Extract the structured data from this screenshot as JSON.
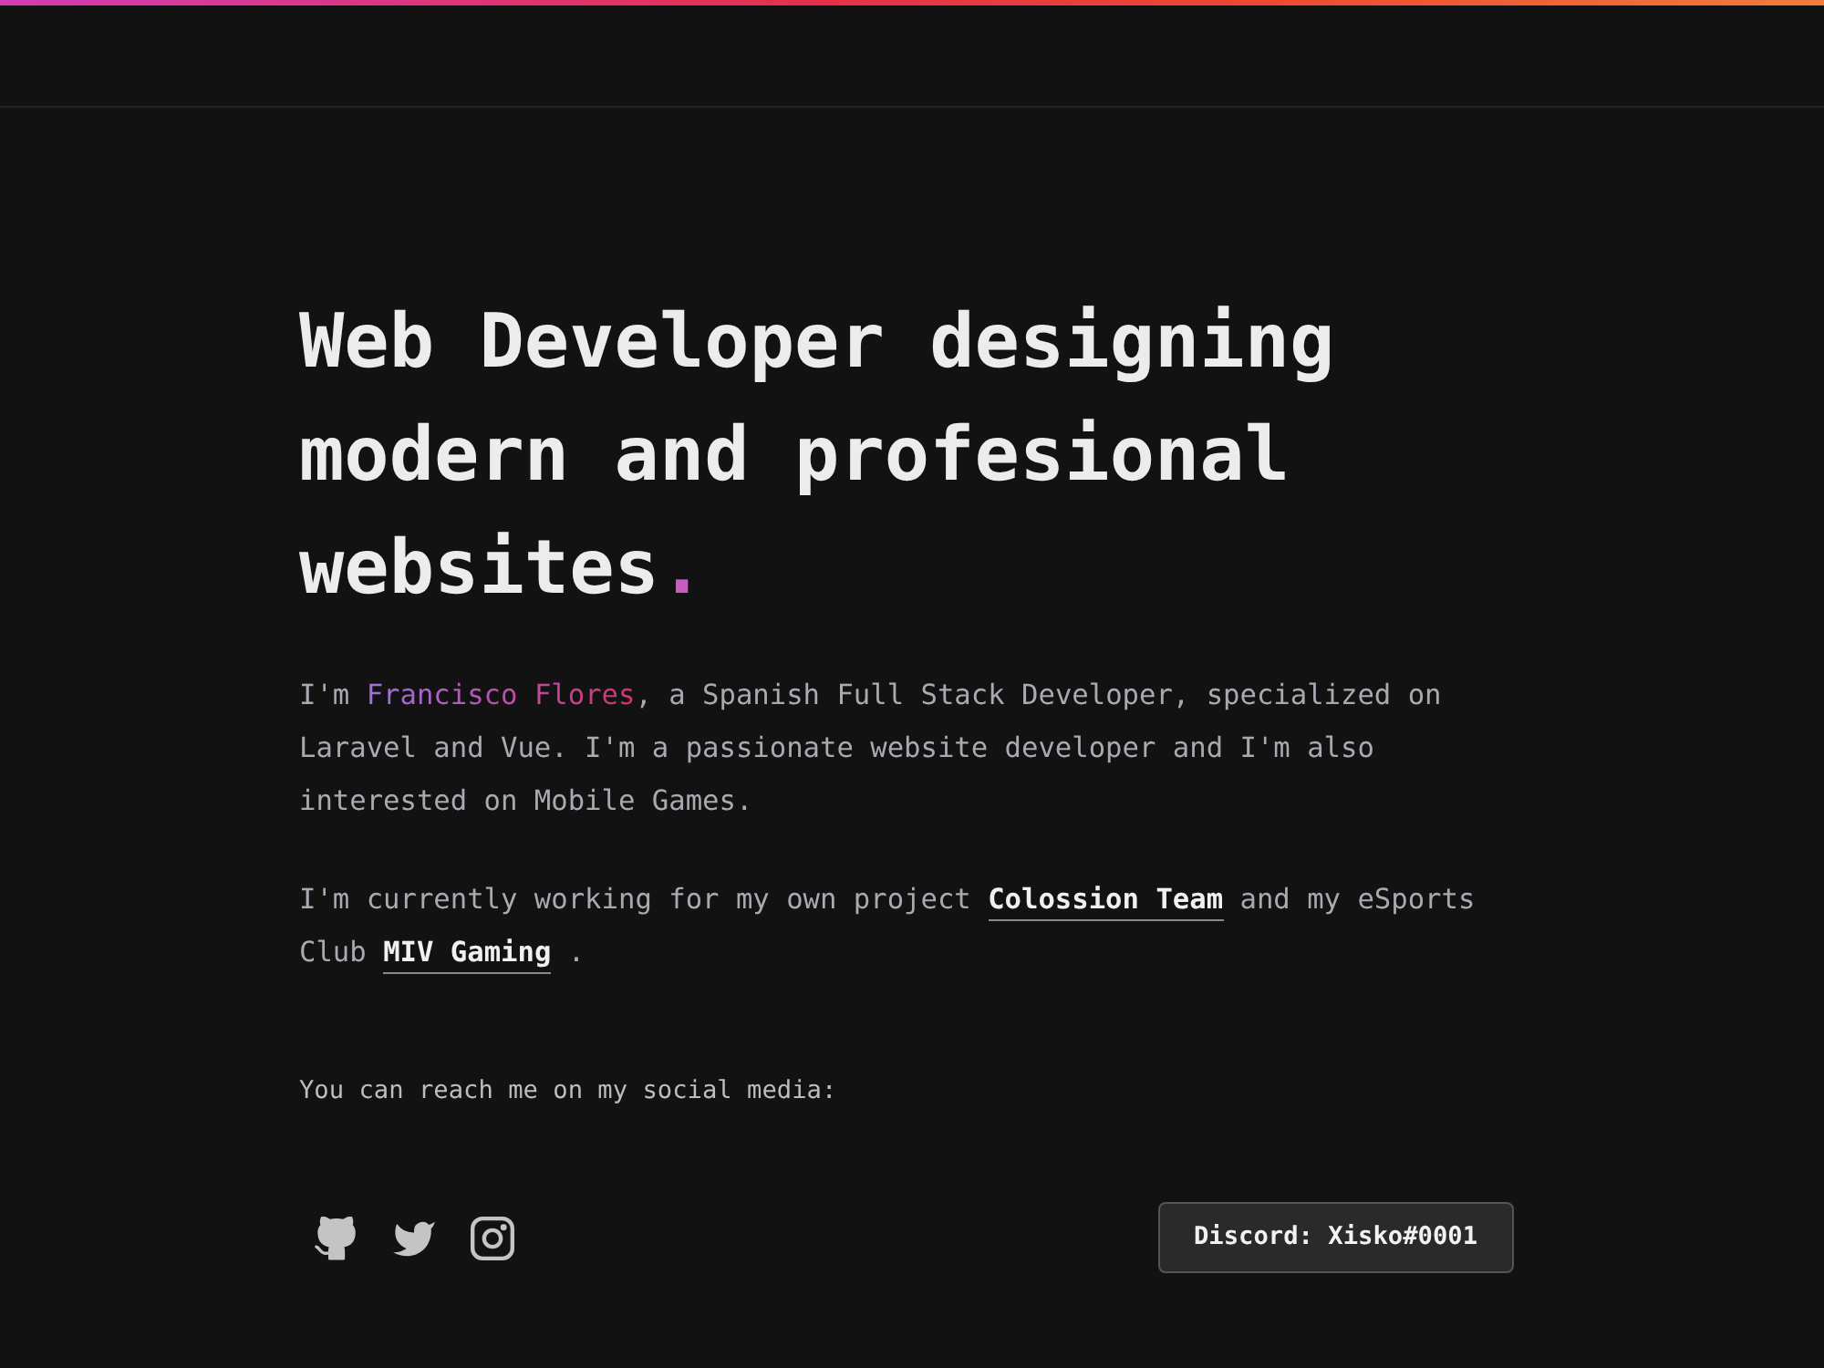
{
  "hero": {
    "heading": "Web Developer designing modern and profesional websites",
    "heading_end": "."
  },
  "paragraphs": [
    {
      "segments": [
        {
          "kind": "text",
          "text": "I'm "
        },
        {
          "kind": "highlight",
          "text": "Francisco Flores"
        },
        {
          "kind": "text",
          "text": ", a Spanish Full Stack Developer, specialized on Laravel and Vue. I'm a passionate website developer and I'm also interested on Mobile Games."
        }
      ]
    },
    {
      "segments": [
        {
          "kind": "text",
          "text": "I'm currently working for my own project "
        },
        {
          "kind": "link",
          "text": "Colossion Team"
        },
        {
          "kind": "text",
          "text": " and my eSports Club "
        },
        {
          "kind": "link",
          "text": "MIV Gaming"
        },
        {
          "kind": "text",
          "text": " ."
        }
      ]
    }
  ],
  "contact_prompt": "You can reach me on my social media:",
  "social_links": [
    {
      "kind": "github"
    },
    {
      "kind": "twitter"
    },
    {
      "kind": "instagram"
    }
  ],
  "discord_button": {
    "label": "Discord: Xisko#0001"
  }
}
